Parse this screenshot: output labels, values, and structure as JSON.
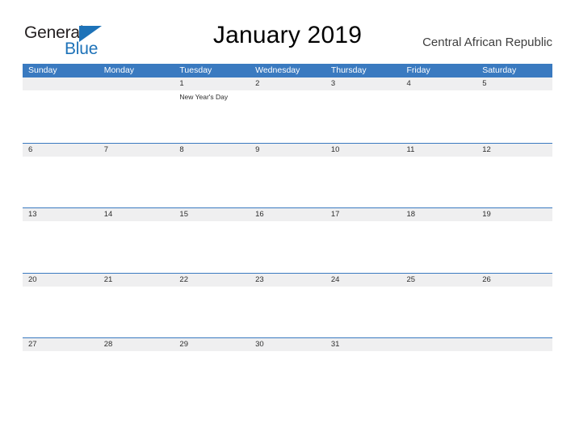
{
  "brand": {
    "name_part1": "General",
    "name_part2": "Blue",
    "color_dark": "#231f20",
    "color_blue": "#1d72b8"
  },
  "header": {
    "title": "January 2019",
    "region": "Central African Republic"
  },
  "theme": {
    "header_blue": "#3a7ac0",
    "date_strip_gray": "#efeff0",
    "text_dark": "#2d2d2d",
    "page_background": "#ffffff"
  },
  "calendar": {
    "weekday_headers": [
      "Sunday",
      "Monday",
      "Tuesday",
      "Wednesday",
      "Thursday",
      "Friday",
      "Saturday"
    ],
    "weeks": [
      {
        "days": [
          {
            "date": "",
            "event": ""
          },
          {
            "date": "",
            "event": ""
          },
          {
            "date": "1",
            "event": "New Year's Day"
          },
          {
            "date": "2",
            "event": ""
          },
          {
            "date": "3",
            "event": ""
          },
          {
            "date": "4",
            "event": ""
          },
          {
            "date": "5",
            "event": ""
          }
        ]
      },
      {
        "days": [
          {
            "date": "6",
            "event": ""
          },
          {
            "date": "7",
            "event": ""
          },
          {
            "date": "8",
            "event": ""
          },
          {
            "date": "9",
            "event": ""
          },
          {
            "date": "10",
            "event": ""
          },
          {
            "date": "11",
            "event": ""
          },
          {
            "date": "12",
            "event": ""
          }
        ]
      },
      {
        "days": [
          {
            "date": "13",
            "event": ""
          },
          {
            "date": "14",
            "event": ""
          },
          {
            "date": "15",
            "event": ""
          },
          {
            "date": "16",
            "event": ""
          },
          {
            "date": "17",
            "event": ""
          },
          {
            "date": "18",
            "event": ""
          },
          {
            "date": "19",
            "event": ""
          }
        ]
      },
      {
        "days": [
          {
            "date": "20",
            "event": ""
          },
          {
            "date": "21",
            "event": ""
          },
          {
            "date": "22",
            "event": ""
          },
          {
            "date": "23",
            "event": ""
          },
          {
            "date": "24",
            "event": ""
          },
          {
            "date": "25",
            "event": ""
          },
          {
            "date": "26",
            "event": ""
          }
        ]
      },
      {
        "days": [
          {
            "date": "27",
            "event": ""
          },
          {
            "date": "28",
            "event": ""
          },
          {
            "date": "29",
            "event": ""
          },
          {
            "date": "30",
            "event": ""
          },
          {
            "date": "31",
            "event": ""
          },
          {
            "date": "",
            "event": ""
          },
          {
            "date": "",
            "event": ""
          }
        ]
      }
    ]
  }
}
